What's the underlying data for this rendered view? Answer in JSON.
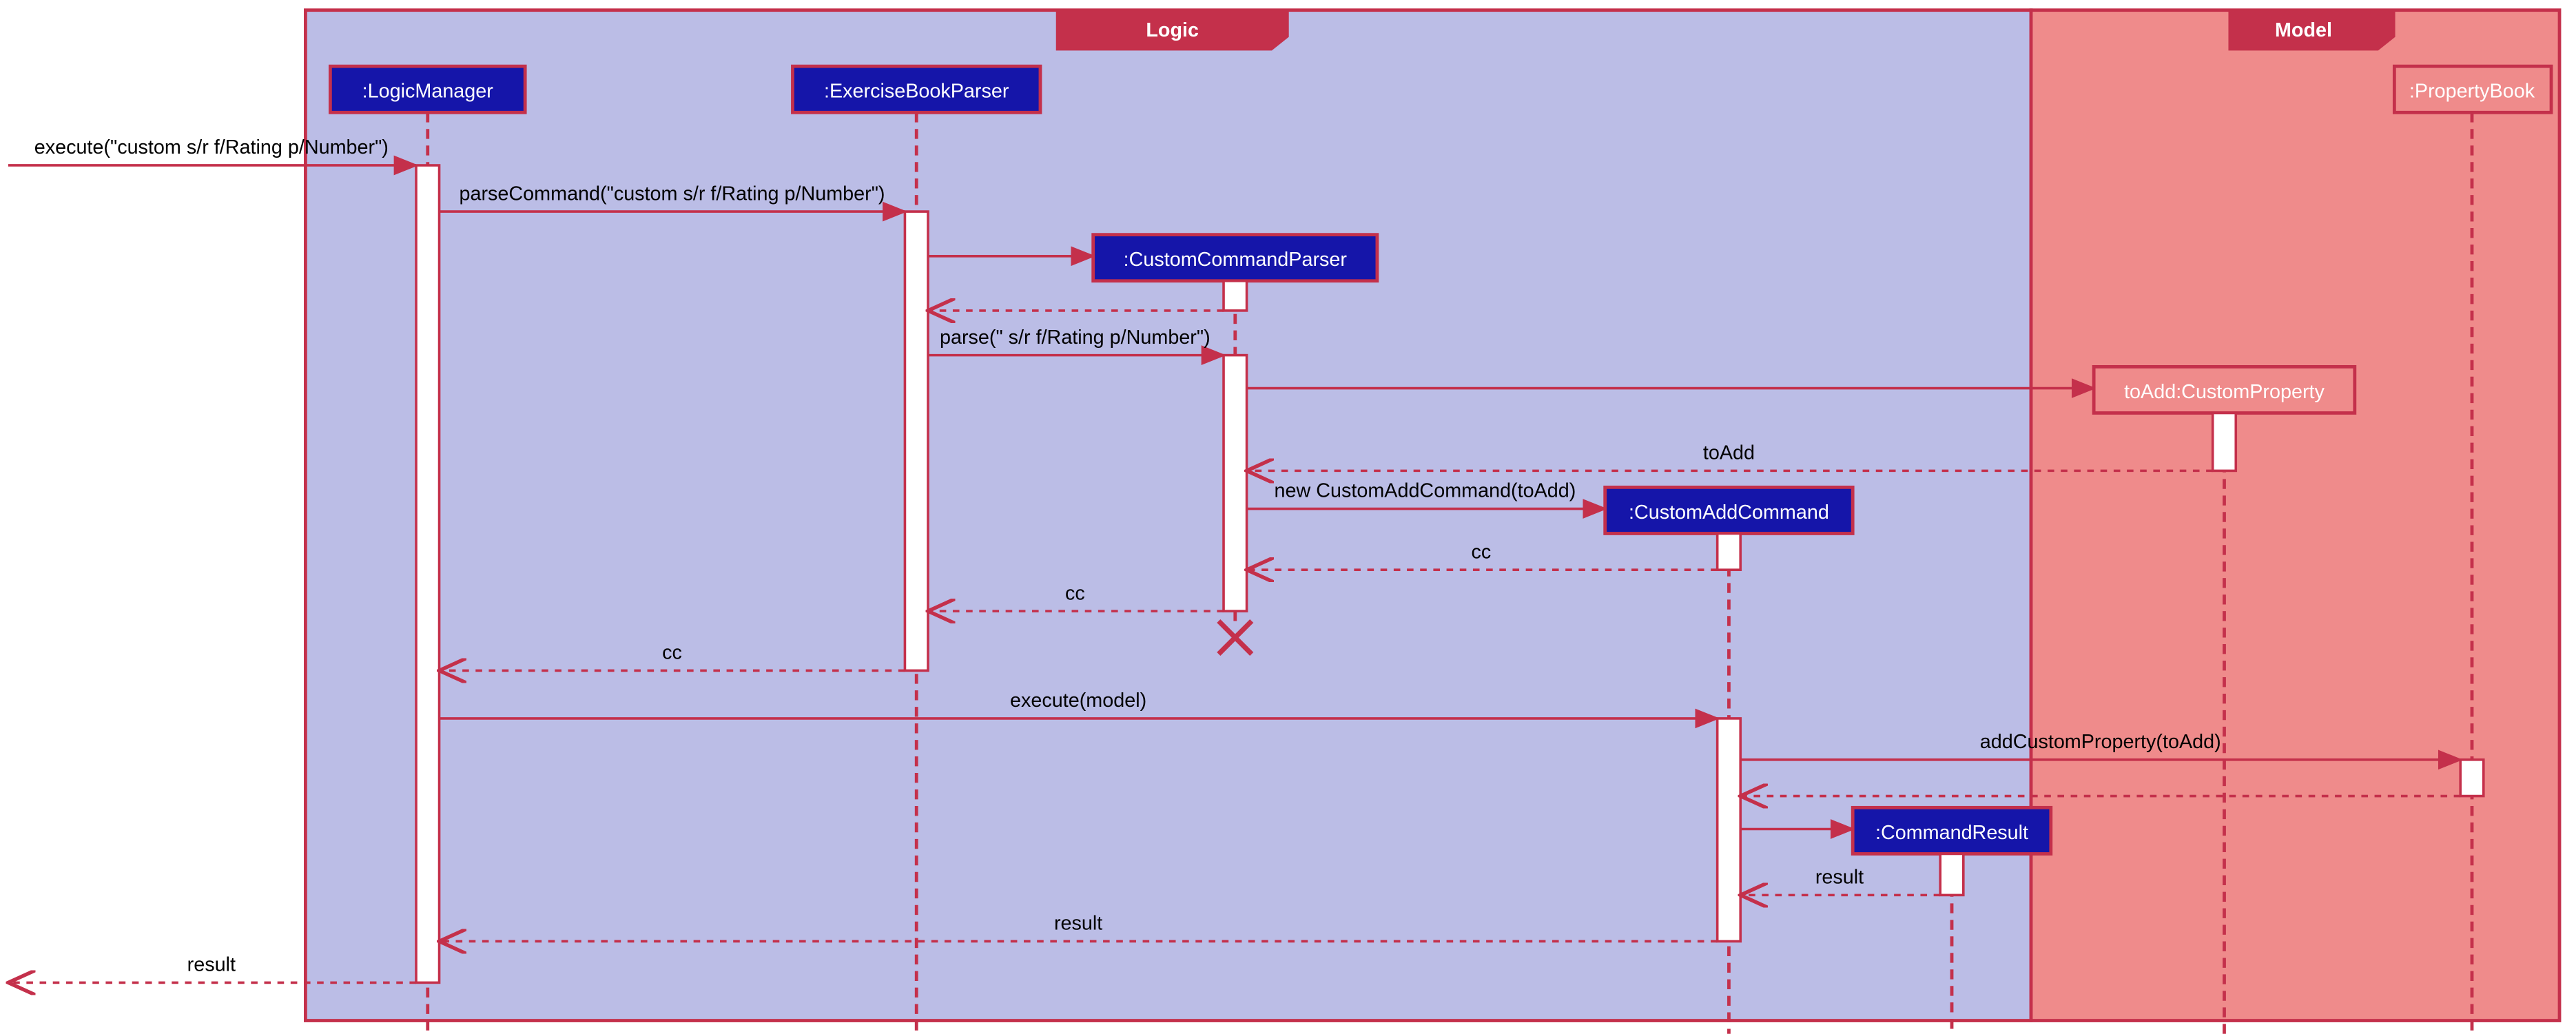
{
  "frames": {
    "logic": "Logic",
    "model": "Model"
  },
  "participants": {
    "logicManager": ":LogicManager",
    "exerciseBookParser": ":ExerciseBookParser",
    "customCommandParser": ":CustomCommandParser",
    "customAddCommand": ":CustomAddCommand",
    "commandResult": ":CommandResult",
    "propertyBook": ":PropertyBook",
    "customProperty": "toAdd:CustomProperty"
  },
  "messages": {
    "m1": "execute(\"custom s/r f/Rating p/Number\")",
    "m2": "parseCommand(\"custom s/r f/Rating p/Number\")",
    "m3": "parse(\" s/r f/Rating p/Number\")",
    "m4": "toAdd",
    "m5": "new CustomAddCommand(toAdd)",
    "m6": "cc",
    "m7": "cc",
    "m8": "cc",
    "m9": "execute(model)",
    "m10": "addCustomProperty(toAdd)",
    "m11": "result",
    "m12": "result",
    "m13": "result"
  },
  "chart_data": {
    "type": "uml-sequence-diagram",
    "frames": [
      {
        "name": "Logic",
        "contains": [
          "LogicManager",
          "ExerciseBookParser",
          "CustomCommandParser",
          "CustomAddCommand",
          "CommandResult"
        ]
      },
      {
        "name": "Model",
        "contains": [
          "PropertyBook",
          "toAdd:CustomProperty"
        ]
      }
    ],
    "participants": [
      {
        "id": "external",
        "label": ""
      },
      {
        "id": "LogicManager",
        "label": ":LogicManager"
      },
      {
        "id": "ExerciseBookParser",
        "label": ":ExerciseBookParser"
      },
      {
        "id": "CustomCommandParser",
        "label": ":CustomCommandParser",
        "destroyed": true
      },
      {
        "id": "CustomAddCommand",
        "label": ":CustomAddCommand"
      },
      {
        "id": "CommandResult",
        "label": ":CommandResult"
      },
      {
        "id": "PropertyBook",
        "label": ":PropertyBook"
      },
      {
        "id": "CustomProperty",
        "label": "toAdd:CustomProperty"
      }
    ],
    "messages": [
      {
        "from": "external",
        "to": "LogicManager",
        "label": "execute(\"custom s/r f/Rating p/Number\")",
        "type": "sync"
      },
      {
        "from": "LogicManager",
        "to": "ExerciseBookParser",
        "label": "parseCommand(\"custom s/r f/Rating p/Number\")",
        "type": "sync"
      },
      {
        "from": "ExerciseBookParser",
        "to": "CustomCommandParser",
        "label": "",
        "type": "create"
      },
      {
        "from": "CustomCommandParser",
        "to": "ExerciseBookParser",
        "label": "",
        "type": "return"
      },
      {
        "from": "ExerciseBookParser",
        "to": "CustomCommandParser",
        "label": "parse(\" s/r f/Rating p/Number\")",
        "type": "sync"
      },
      {
        "from": "CustomCommandParser",
        "to": "CustomProperty",
        "label": "",
        "type": "create"
      },
      {
        "from": "CustomProperty",
        "to": "CustomCommandParser",
        "label": "toAdd",
        "type": "return"
      },
      {
        "from": "CustomCommandParser",
        "to": "CustomAddCommand",
        "label": "new CustomAddCommand(toAdd)",
        "type": "create"
      },
      {
        "from": "CustomAddCommand",
        "to": "CustomCommandParser",
        "label": "cc",
        "type": "return"
      },
      {
        "from": "CustomCommandParser",
        "to": "ExerciseBookParser",
        "label": "cc",
        "type": "return"
      },
      {
        "from": "ExerciseBookParser",
        "to": "LogicManager",
        "label": "cc",
        "type": "return"
      },
      {
        "from": "LogicManager",
        "to": "CustomAddCommand",
        "label": "execute(model)",
        "type": "sync"
      },
      {
        "from": "CustomAddCommand",
        "to": "PropertyBook",
        "label": "addCustomProperty(toAdd)",
        "type": "sync"
      },
      {
        "from": "PropertyBook",
        "to": "CustomAddCommand",
        "label": "",
        "type": "return"
      },
      {
        "from": "CustomAddCommand",
        "to": "CommandResult",
        "label": "",
        "type": "create"
      },
      {
        "from": "CommandResult",
        "to": "CustomAddCommand",
        "label": "result",
        "type": "return"
      },
      {
        "from": "CustomAddCommand",
        "to": "LogicManager",
        "label": "result",
        "type": "return"
      },
      {
        "from": "LogicManager",
        "to": "external",
        "label": "result",
        "type": "return"
      }
    ]
  }
}
